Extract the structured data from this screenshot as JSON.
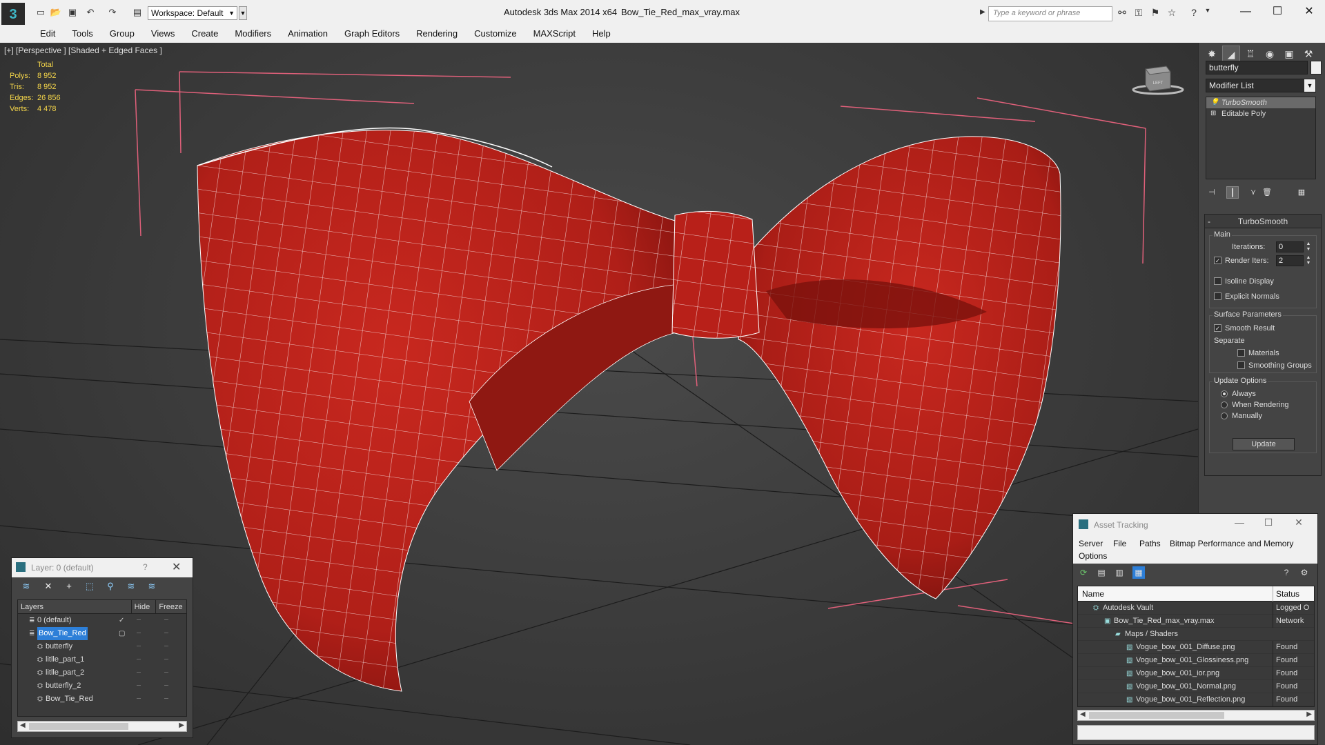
{
  "titlebar": {
    "app_title": "Autodesk 3ds Max  2014 x64",
    "file_title": "Bow_Tie_Red_max_vray.max",
    "workspace": "Workspace: Default",
    "search_placeholder": "Type a keyword or phrase",
    "quick_access_icons": [
      "new-file-icon",
      "open-file-icon",
      "save-icon",
      "undo-icon",
      "redo-icon",
      "project-folder-icon"
    ],
    "toolbar_icons": [
      "binoculars-icon",
      "key-icon",
      "favorites-icon",
      "star-icon",
      "help-icon"
    ],
    "window_controls": {
      "minimize": "—",
      "maximize": "☐",
      "close": "✕"
    }
  },
  "menu": {
    "items": [
      "Edit",
      "Tools",
      "Group",
      "Views",
      "Create",
      "Modifiers",
      "Animation",
      "Graph Editors",
      "Rendering",
      "Customize",
      "MAXScript",
      "Help"
    ]
  },
  "viewport": {
    "label": "[+] [Perspective ] [Shaded + Edged Faces ]",
    "stats": {
      "header": "Total",
      "rows": [
        {
          "k": "Polys:",
          "v": "8 952"
        },
        {
          "k": "Tris:",
          "v": "8 952"
        },
        {
          "k": "Edges:",
          "v": "26 856"
        },
        {
          "k": "Verts:",
          "v": "4 478"
        }
      ]
    },
    "viewcube_label": "LEFT",
    "model_color": "#c0231c",
    "wire_color": "#ffffff",
    "bbox_color": "#e0607a"
  },
  "command_panel": {
    "object_name": "butterfly",
    "modifier_list": "Modifier List",
    "stack": [
      {
        "label": "TurboSmooth",
        "selected": true
      },
      {
        "label": "Editable Poly",
        "selected": false
      }
    ],
    "rollout_title": "TurboSmooth",
    "main_group": "Main",
    "iterations_label": "Iterations:",
    "iterations_value": "0",
    "render_iters_label": "Render Iters:",
    "render_iters_value": "2",
    "render_iters_checked": true,
    "isoline_label": "Isoline Display",
    "explicit_normals_label": "Explicit Normals",
    "surface_group": "Surface Parameters",
    "smooth_result_label": "Smooth Result",
    "separate_label": "Separate",
    "materials_label": "Materials",
    "smoothing_groups_label": "Smoothing Groups",
    "update_group": "Update Options",
    "always_label": "Always",
    "when_rendering_label": "When Rendering",
    "manually_label": "Manually",
    "update_button": "Update"
  },
  "layer_window": {
    "title": "Layer: 0 (default)",
    "help": "?",
    "close": "✕",
    "col_layers": "Layers",
    "col_hide": "Hide",
    "col_freeze": "Freeze",
    "rows": [
      {
        "name": "0 (default)",
        "indent": 1,
        "selected": false,
        "current": true
      },
      {
        "name": "Bow_Tie_Red",
        "indent": 1,
        "selected": true,
        "current": false
      },
      {
        "name": "butterfly",
        "indent": 2,
        "selected": false,
        "current": false
      },
      {
        "name": "litlle_part_1",
        "indent": 2,
        "selected": false,
        "current": false
      },
      {
        "name": "litlle_part_2",
        "indent": 2,
        "selected": false,
        "current": false
      },
      {
        "name": "butterfly_2",
        "indent": 2,
        "selected": false,
        "current": false
      },
      {
        "name": "Bow_Tie_Red",
        "indent": 2,
        "selected": false,
        "current": false
      }
    ]
  },
  "asset_window": {
    "title": "Asset Tracking",
    "menu": [
      "Server",
      "File",
      "Paths",
      "Bitmap Performance and Memory",
      "Options"
    ],
    "col_name": "Name",
    "col_status": "Status",
    "rows": [
      {
        "name": "Autodesk Vault",
        "indent": 1,
        "status": "Logged O"
      },
      {
        "name": "Bow_Tie_Red_max_vray.max",
        "indent": 2,
        "status": "Network"
      },
      {
        "name": "Maps / Shaders",
        "indent": 3,
        "status": ""
      },
      {
        "name": "Vogue_bow_001_Diffuse.png",
        "indent": 4,
        "status": "Found"
      },
      {
        "name": "Vogue_bow_001_Glossiness.png",
        "indent": 4,
        "status": "Found"
      },
      {
        "name": "Vogue_bow_001_ior.png",
        "indent": 4,
        "status": "Found"
      },
      {
        "name": "Vogue_bow_001_Normal.png",
        "indent": 4,
        "status": "Found"
      },
      {
        "name": "Vogue_bow_001_Reflection.png",
        "indent": 4,
        "status": "Found"
      }
    ]
  }
}
